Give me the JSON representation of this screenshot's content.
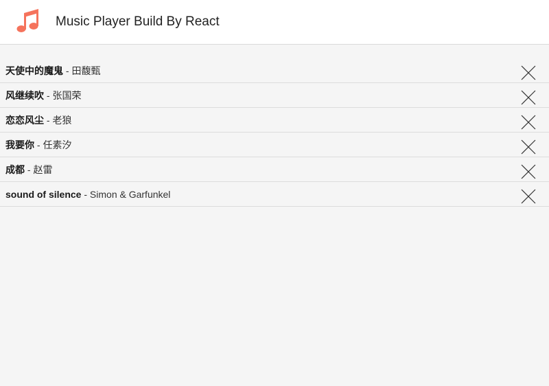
{
  "header": {
    "title": "Music Player Build By React",
    "logo_icon": "music-note-icon",
    "accent_color": "#f5735c"
  },
  "playlist": {
    "separator": " - ",
    "items": [
      {
        "title": "天使中的魔鬼",
        "artist": "田馥甄"
      },
      {
        "title": "风继续吹",
        "artist": "张国荣"
      },
      {
        "title": "恋恋风尘",
        "artist": "老狼"
      },
      {
        "title": "我要你",
        "artist": "任素汐"
      },
      {
        "title": "成都",
        "artist": "赵雷"
      },
      {
        "title": "sound of silence",
        "artist": "Simon & Garfunkel"
      }
    ],
    "delete_icon": "close-icon"
  }
}
